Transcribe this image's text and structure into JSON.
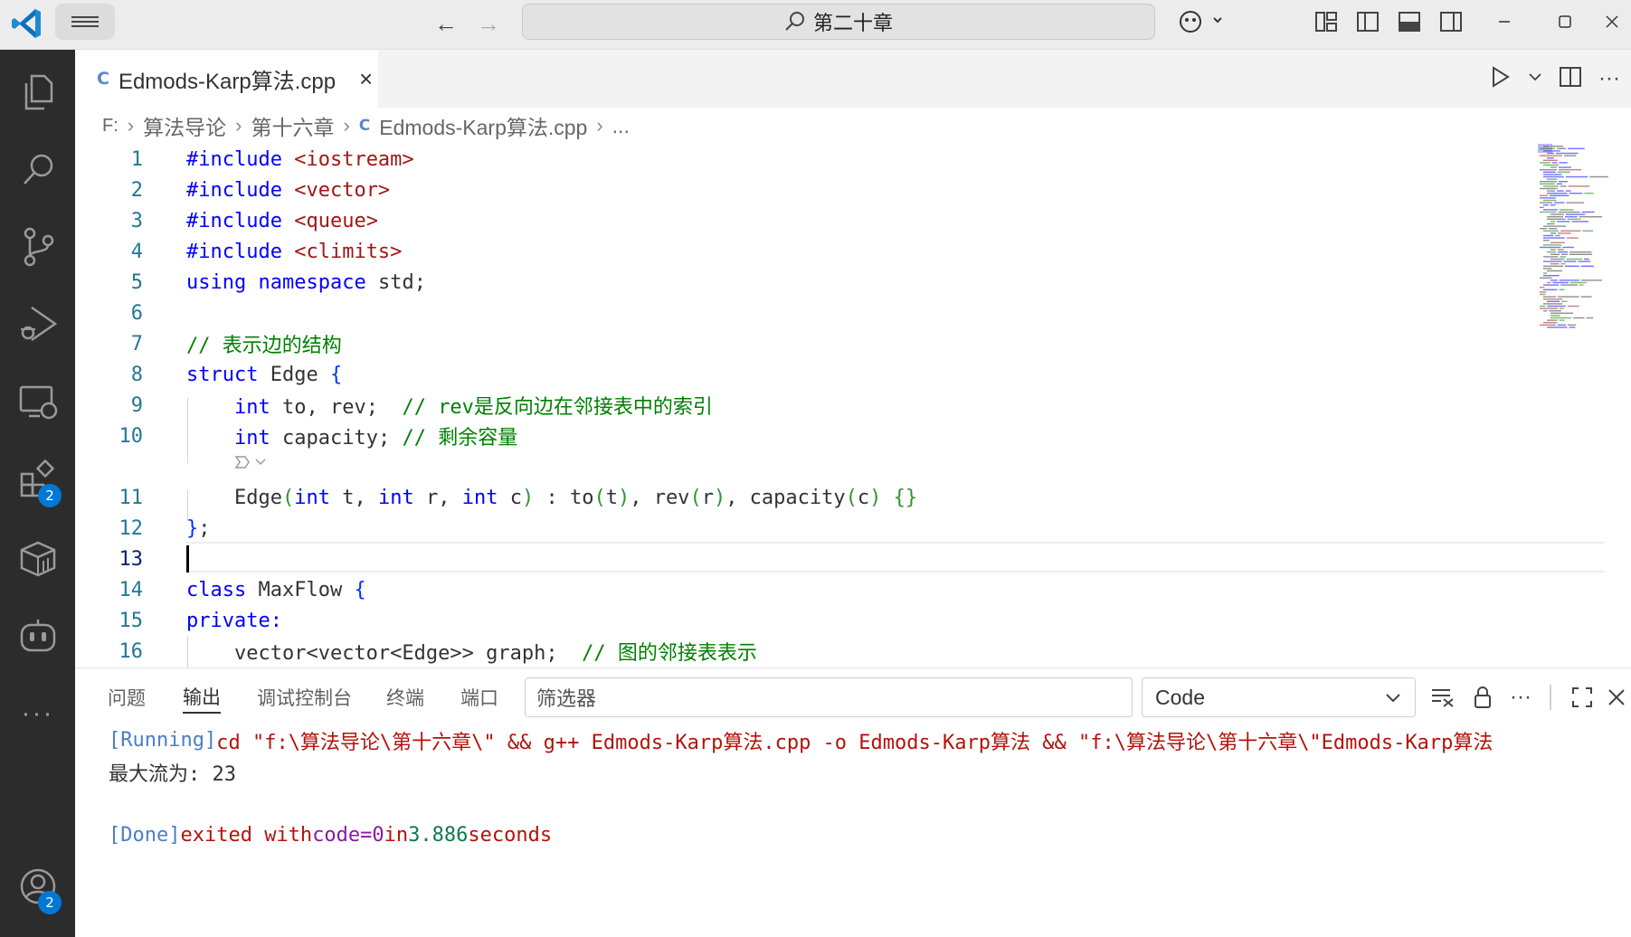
{
  "titlebar": {
    "search_text": "第二十章"
  },
  "tab": {
    "icon_text": "C",
    "filename": "Edmods-Karp算法.cpp",
    "close": "×"
  },
  "breadcrumb": {
    "items": [
      "F:",
      "算法导论",
      "第十六章",
      "Edmods-Karp算法.cpp",
      "..."
    ]
  },
  "activity": {
    "extensions_badge": "2",
    "accounts_badge": "2"
  },
  "editor": {
    "line_numbers": [
      "1",
      "2",
      "3",
      "4",
      "5",
      "6",
      "7",
      "8",
      "9",
      "10",
      "11",
      "12",
      "13",
      "14",
      "15",
      "16"
    ],
    "current_line": "13",
    "code": {
      "l1_a": "#include",
      "l1_b": "<iostream>",
      "l2_a": "#include",
      "l2_b": "<vector>",
      "l3_a": "#include",
      "l3_b": "<queue>",
      "l4_a": "#include",
      "l4_b": "<climits>",
      "l5_a": "using",
      "l5_b": "namespace",
      "l5_c": "std;",
      "l7": "// 表示边的结构",
      "l8_a": "struct",
      "l8_b": "Edge",
      "l8_c": "{",
      "l9_a": "int",
      "l9_b": "to, rev;",
      "l9_c": "// rev是反向边在邻接表中的索引",
      "l10_a": "int",
      "l10_b": "capacity;",
      "l10_c": "// 剩余容量",
      "l11_a": "Edge",
      "l11_b": "(",
      "l11_c": "int",
      "l11_d": "t,",
      "l11_e": "int",
      "l11_f": "r,",
      "l11_g": "int",
      "l11_h": "c",
      "l11_i": ")",
      "l11_j": ": to",
      "l11_k": "(",
      "l11_l": "t",
      "l11_m": ")",
      "l11_n": ", rev",
      "l11_o": "(",
      "l11_p": "r",
      "l11_q": ")",
      "l11_r": ", capacity",
      "l11_s": "(",
      "l11_t": "c",
      "l11_u": ")",
      "l11_v": "{}",
      "l12_a": "}",
      "l12_b": ";",
      "l14_a": "class",
      "l14_b": "MaxFlow",
      "l14_c": "{",
      "l15": "private:",
      "l16_a": "vector<vector<Edge>> graph;",
      "l16_b": "// 图的邻接表表示"
    }
  },
  "panel": {
    "tabs": [
      "问题",
      "输出",
      "调试控制台",
      "终端",
      "端口"
    ],
    "active_tab": "输出",
    "filter_placeholder": "筛选器",
    "channel": "Code",
    "output": {
      "running_tag": "[Running]",
      "running_cmd": "cd \"f:\\算法导论\\第十六章\\\" && g++ Edmods-Karp算法.cpp -o Edmods-Karp算法 && \"f:\\算法导论\\第十六章\\\"Edmods-Karp算法",
      "result": "最大流为: 23",
      "done_tag": "[Done]",
      "done_exit": "exited with",
      "done_code": "code=0",
      "done_in": "in",
      "done_secs": "3.886",
      "done_seconds": "seconds"
    }
  },
  "colors": {
    "accent": "#0078d4",
    "activitybar": "#2c2c2c",
    "keyword": "#0000ff",
    "string": "#a31515",
    "comment": "#008000"
  }
}
